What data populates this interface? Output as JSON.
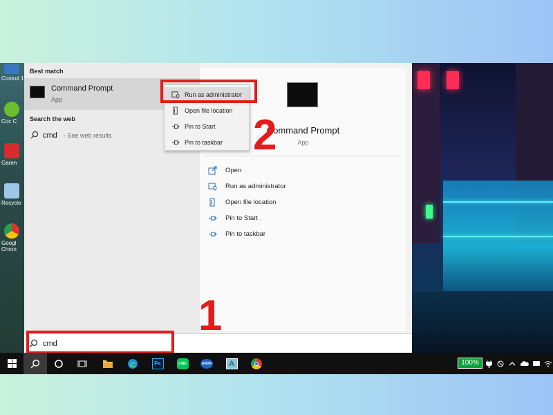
{
  "desktop": {
    "icons": [
      {
        "label": "Control 1",
        "color": "#3a78c4"
      },
      {
        "label": "Coc C",
        "color": "#6bbf2b"
      },
      {
        "label": "Garen",
        "color": "#d82b2b"
      },
      {
        "label": "Recycle",
        "color": "#9cc7e8"
      },
      {
        "label": "Googl Chron",
        "color": "#e8b71a"
      }
    ]
  },
  "start_menu": {
    "best_match_label": "Best match",
    "best_match": {
      "title": "Command Prompt",
      "subtitle": "App"
    },
    "search_web_label": "Search the web",
    "web_result": {
      "term": "cmd",
      "hint": "- See web results"
    },
    "preview": {
      "title": "Command Prompt",
      "subtitle": "App"
    },
    "actions": [
      {
        "label": "Open",
        "icon": "open-icon"
      },
      {
        "label": "Run as administrator",
        "icon": "shield-icon"
      },
      {
        "label": "Open file location",
        "icon": "file-location-icon"
      },
      {
        "label": "Pin to Start",
        "icon": "pin-icon"
      },
      {
        "label": "Pin to taskbar",
        "icon": "pin-icon"
      }
    ],
    "search_value": "cmd"
  },
  "context_menu": {
    "items": [
      {
        "label": "Run as administrator",
        "icon": "shield-icon"
      },
      {
        "label": "Open file location",
        "icon": "file-location-icon"
      },
      {
        "label": "Pin to Start",
        "icon": "pin-icon"
      },
      {
        "label": "Pin to taskbar",
        "icon": "pin-icon"
      }
    ]
  },
  "annotations": {
    "step1": "1",
    "step2": "2",
    "color": "#e61b1b"
  },
  "taskbar": {
    "apps": [
      "windows-start-icon",
      "search-icon",
      "cortana-icon",
      "task-view-icon",
      "file-explorer-icon",
      "edge-icon",
      "photoshop-icon",
      "line-icon",
      "android-emulator-icon",
      "app-a-icon",
      "chrome-icon"
    ],
    "photoshop_label": "Ps",
    "line_label": "LINE",
    "android_label": "ANDR",
    "battery": "100%"
  }
}
